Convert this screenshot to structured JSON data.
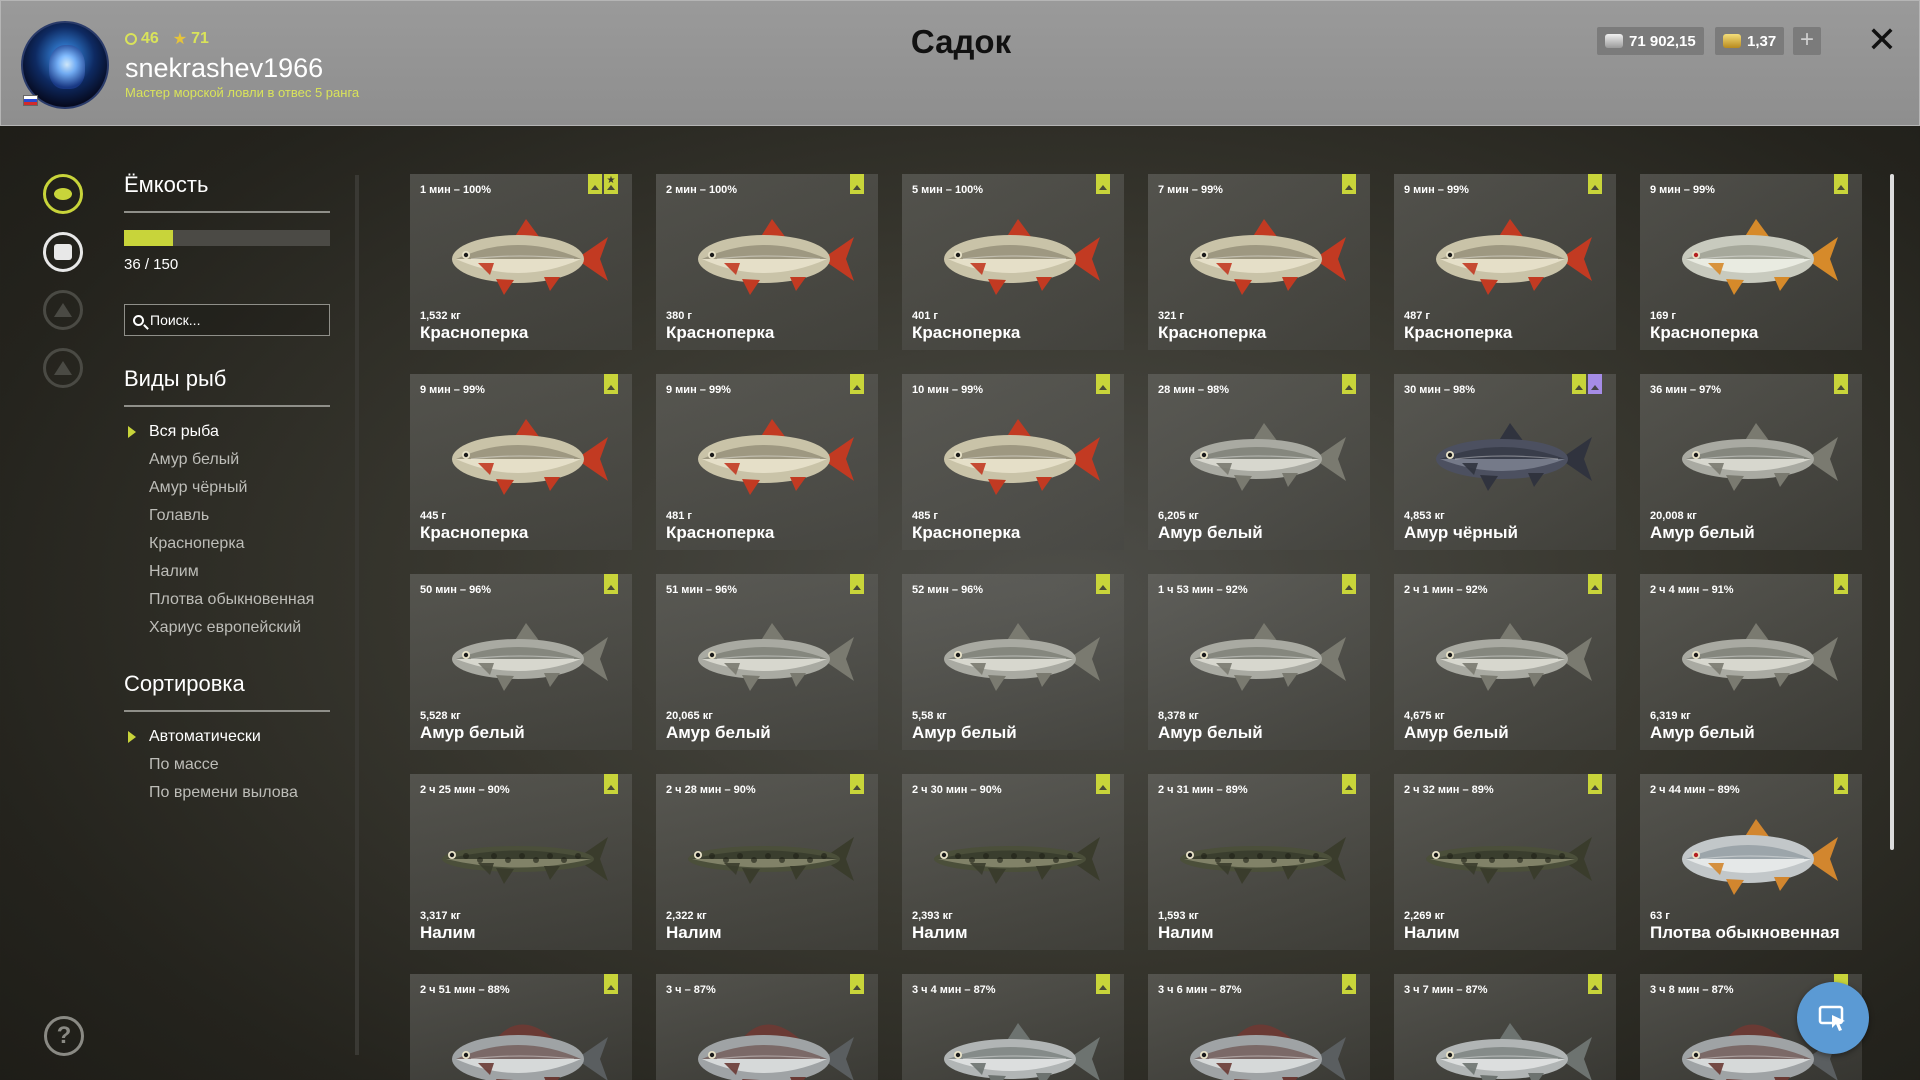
{
  "header": {
    "title": "Садок",
    "username": "snekrashev1966",
    "rank": "Мастер морской ловли в отвес 5 ранга",
    "level": "46",
    "stars": "71",
    "silver": "71 902,15",
    "gold": "1,37"
  },
  "sidebar": {
    "capacity_title": "Ёмкость",
    "capacity_text": "36 / 150",
    "capacity_used": 36,
    "capacity_total": 150,
    "search_placeholder": "Поиск...",
    "species_title": "Виды рыб",
    "species": [
      "Вся рыба",
      "Амур белый",
      "Амур чёрный",
      "Голавль",
      "Красноперка",
      "Налим",
      "Плотва обыкновенная",
      "Хариус европейский"
    ],
    "sort_title": "Сортировка",
    "sort_options": [
      "Автоматически",
      "По массе",
      "По времени вылова"
    ]
  },
  "fish": [
    {
      "time": "1 мин – 100%",
      "weight": "1,532 кг",
      "name": "Красноперка",
      "type": "rudd",
      "star": true,
      "trophy": false
    },
    {
      "time": "2 мин – 100%",
      "weight": "380 г",
      "name": "Красноперка",
      "type": "rudd",
      "star": false,
      "trophy": false
    },
    {
      "time": "5 мин – 100%",
      "weight": "401 г",
      "name": "Красноперка",
      "type": "rudd",
      "star": false,
      "trophy": false
    },
    {
      "time": "7 мин – 99%",
      "weight": "321 г",
      "name": "Красноперка",
      "type": "rudd",
      "star": false,
      "trophy": false
    },
    {
      "time": "9 мин – 99%",
      "weight": "487 г",
      "name": "Красноперка",
      "type": "rudd",
      "star": false,
      "trophy": false
    },
    {
      "time": "9 мин – 99%",
      "weight": "169 г",
      "name": "Красноперка",
      "type": "rudd-silver",
      "star": false,
      "trophy": false
    },
    {
      "time": "9 мин – 99%",
      "weight": "445 г",
      "name": "Красноперка",
      "type": "rudd",
      "star": false,
      "trophy": false
    },
    {
      "time": "9 мин – 99%",
      "weight": "481 г",
      "name": "Красноперка",
      "type": "rudd",
      "star": false,
      "trophy": false
    },
    {
      "time": "10 мин – 99%",
      "weight": "485 г",
      "name": "Красноперка",
      "type": "rudd",
      "star": false,
      "trophy": false
    },
    {
      "time": "28 мин – 98%",
      "weight": "6,205 кг",
      "name": "Амур белый",
      "type": "carp",
      "star": false,
      "trophy": false
    },
    {
      "time": "30 мин – 98%",
      "weight": "4,853 кг",
      "name": "Амур чёрный",
      "type": "carp-dark",
      "star": false,
      "trophy": true
    },
    {
      "time": "36 мин – 97%",
      "weight": "20,008 кг",
      "name": "Амур белый",
      "type": "carp",
      "star": false,
      "trophy": false
    },
    {
      "time": "50 мин – 96%",
      "weight": "5,528 кг",
      "name": "Амур белый",
      "type": "carp",
      "star": false,
      "trophy": false
    },
    {
      "time": "51 мин – 96%",
      "weight": "20,065 кг",
      "name": "Амур белый",
      "type": "carp",
      "star": false,
      "trophy": false
    },
    {
      "time": "52 мин – 96%",
      "weight": "5,58 кг",
      "name": "Амур белый",
      "type": "carp",
      "star": false,
      "trophy": false
    },
    {
      "time": "1 ч 53 мин – 92%",
      "weight": "8,378 кг",
      "name": "Амур белый",
      "type": "carp",
      "star": false,
      "trophy": false
    },
    {
      "time": "2 ч 1 мин – 92%",
      "weight": "4,675 кг",
      "name": "Амур белый",
      "type": "carp",
      "star": false,
      "trophy": false
    },
    {
      "time": "2 ч 4 мин – 91%",
      "weight": "6,319 кг",
      "name": "Амур белый",
      "type": "carp",
      "star": false,
      "trophy": false
    },
    {
      "time": "2 ч 25 мин – 90%",
      "weight": "3,317 кг",
      "name": "Налим",
      "type": "burbot",
      "star": false,
      "trophy": false
    },
    {
      "time": "2 ч 28 мин – 90%",
      "weight": "2,322 кг",
      "name": "Налим",
      "type": "burbot",
      "star": false,
      "trophy": false
    },
    {
      "time": "2 ч 30 мин – 90%",
      "weight": "2,393 кг",
      "name": "Налим",
      "type": "burbot",
      "star": false,
      "trophy": false
    },
    {
      "time": "2 ч 31 мин – 89%",
      "weight": "1,593 кг",
      "name": "Налим",
      "type": "burbot",
      "star": false,
      "trophy": false
    },
    {
      "time": "2 ч 32 мин – 89%",
      "weight": "2,269 кг",
      "name": "Налим",
      "type": "burbot",
      "star": false,
      "trophy": false
    },
    {
      "time": "2 ч 44 мин – 89%",
      "weight": "63 г",
      "name": "Плотва обыкновенная",
      "type": "roach",
      "star": false,
      "trophy": false
    },
    {
      "time": "2 ч 51 мин – 88%",
      "weight": "",
      "name": "",
      "type": "grayling",
      "star": false,
      "trophy": false
    },
    {
      "time": "3 ч – 87%",
      "weight": "",
      "name": "",
      "type": "grayling",
      "star": false,
      "trophy": false
    },
    {
      "time": "3 ч 4 мин – 87%",
      "weight": "",
      "name": "",
      "type": "chub",
      "star": false,
      "trophy": false
    },
    {
      "time": "3 ч 6 мин – 87%",
      "weight": "",
      "name": "",
      "type": "grayling",
      "star": false,
      "trophy": false
    },
    {
      "time": "3 ч 7 мин – 87%",
      "weight": "",
      "name": "",
      "type": "chub",
      "star": false,
      "trophy": false
    },
    {
      "time": "3 ч 8 мин – 87%",
      "weight": "",
      "name": "",
      "type": "grayling",
      "star": false,
      "trophy": false
    }
  ]
}
